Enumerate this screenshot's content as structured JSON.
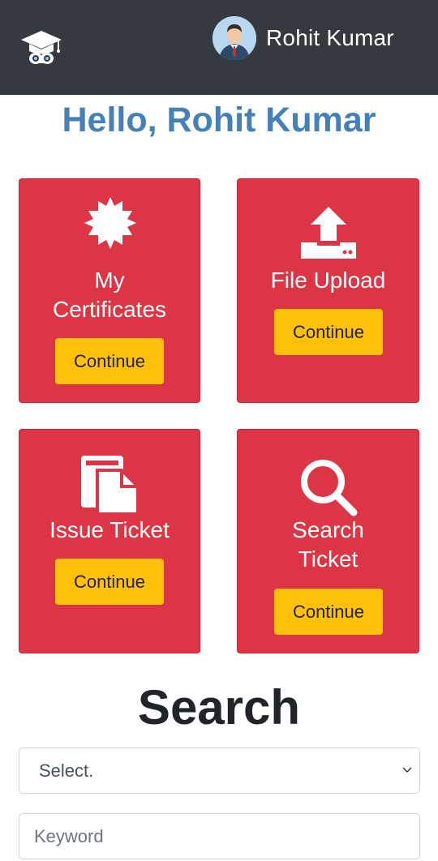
{
  "header": {
    "user_name": "Rohit Kumar",
    "logo_icon": "graduation-cap-owl-icon",
    "avatar_icon": "user-avatar-icon"
  },
  "greeting": "Hello, Rohit Kumar",
  "cards": [
    {
      "icon": "certificate-badge-icon",
      "title_line1": "My",
      "title_line2": "Certificates",
      "button": "Continue"
    },
    {
      "icon": "file-upload-icon",
      "title_line1": "File Upload",
      "button": "Continue"
    },
    {
      "icon": "document-copy-icon",
      "title_line1": "Issue Ticket",
      "button": "Continue"
    },
    {
      "icon": "search-icon",
      "title_line1": "Search",
      "title_line2": "Ticket",
      "button": "Continue"
    }
  ],
  "search": {
    "heading": "Search",
    "select_value": "Select.",
    "keyword_placeholder": "Keyword"
  },
  "colors": {
    "navbar": "#343a40",
    "greeting": "#4580b8",
    "card": "#dc3545",
    "button": "#ffc107"
  }
}
